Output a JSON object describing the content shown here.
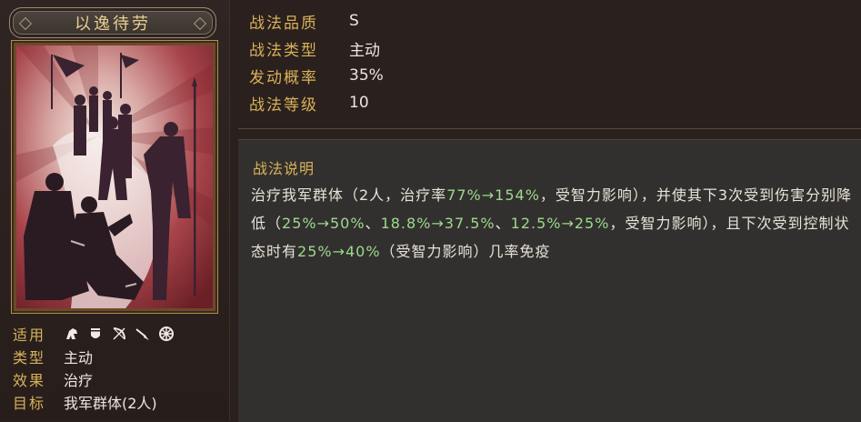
{
  "skill": {
    "name": "以逸待劳"
  },
  "info": {
    "applicable_label": "适用",
    "applicable_icons": [
      "cavalry-icon",
      "shield-icon",
      "bow-icon",
      "spear-icon",
      "wheel-icon"
    ],
    "type_label": "类型",
    "type_value": "主动",
    "effect_label": "效果",
    "effect_value": "治疗",
    "target_label": "目标",
    "target_value": "我军群体(2人)"
  },
  "stats": [
    {
      "label": "战法品质",
      "value": "S"
    },
    {
      "label": "战法类型",
      "value": "主动"
    },
    {
      "label": "发动概率",
      "value": "35%"
    },
    {
      "label": "战法等级",
      "value": "10"
    }
  ],
  "description": {
    "title": "战法说明",
    "seg1": "治疗我军群体（2人，治疗率",
    "hl1": "77%→154%",
    "seg2": "，受智力影响），并使其下3次受到伤害分别降低（",
    "hl2": "25%→50%",
    "seg3": "、",
    "hl3": "18.8%→37.5%",
    "seg4": "、",
    "hl4": "12.5%→25%",
    "seg5": "，受智力影响），且下次受到控制状态时有",
    "hl5": "25%→40%",
    "seg6": "（受智力影响）几率免疫"
  },
  "colors": {
    "label_gold": "#d8b15a",
    "highlight_green": "#9cd98e",
    "card_frame": "#b48a52"
  }
}
